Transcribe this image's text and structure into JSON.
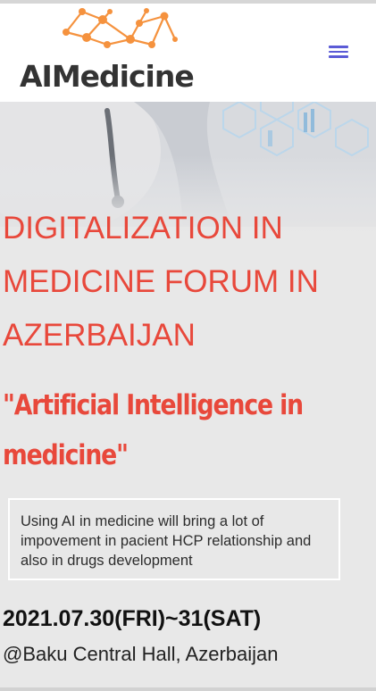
{
  "header": {
    "brand": "AIMedicine",
    "menu_icon": "hamburger-menu-icon",
    "accent_color": "#5b5bd6",
    "logo_color": "#f5923e"
  },
  "hero": {
    "title_line_1": "DIGITALIZATION IN",
    "title_line_2": "MEDICINE FORUM IN",
    "title_line_3": "AZERBAIJAN",
    "subtitle_line_1": "\"Artificial Intelligence in",
    "subtitle_line_2": "medicine\"",
    "note": "Using AI in medicine will bring a lot of impovement in pacient HCP relationship and also in drugs development",
    "date": "2021.07.30(FRI)~31(SAT)",
    "venue": "@Baku Central Hall, Azerbaijan",
    "title_color": "#e8483b"
  }
}
